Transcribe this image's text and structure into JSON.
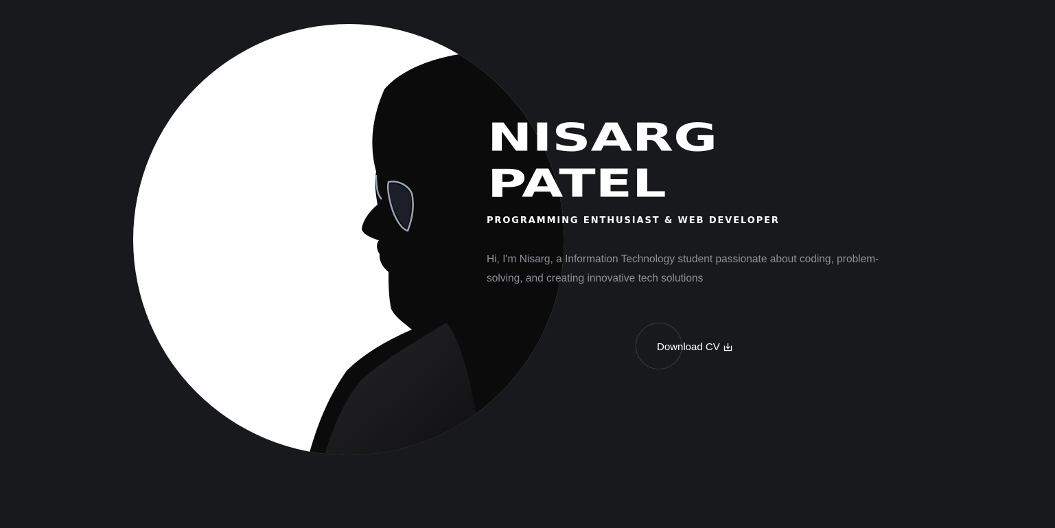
{
  "hero": {
    "first_name": "NISARG",
    "last_name": "PATEL",
    "subtitle": "PROGRAMMING ENTHUSIAST & WEB DEVELOPER",
    "intro": "Hi, I'm Nisarg, a Information Technology student passionate about coding, problem-solving, and creating innovative tech solutions",
    "download_label": "Download CV",
    "download_icon": "download-icon"
  },
  "colors": {
    "background": "#18191d",
    "text": "#ffffff",
    "muted_text": "#8f8f98",
    "portrait_backdrop": "#ffffff",
    "silhouette": "#0b0b0c"
  }
}
